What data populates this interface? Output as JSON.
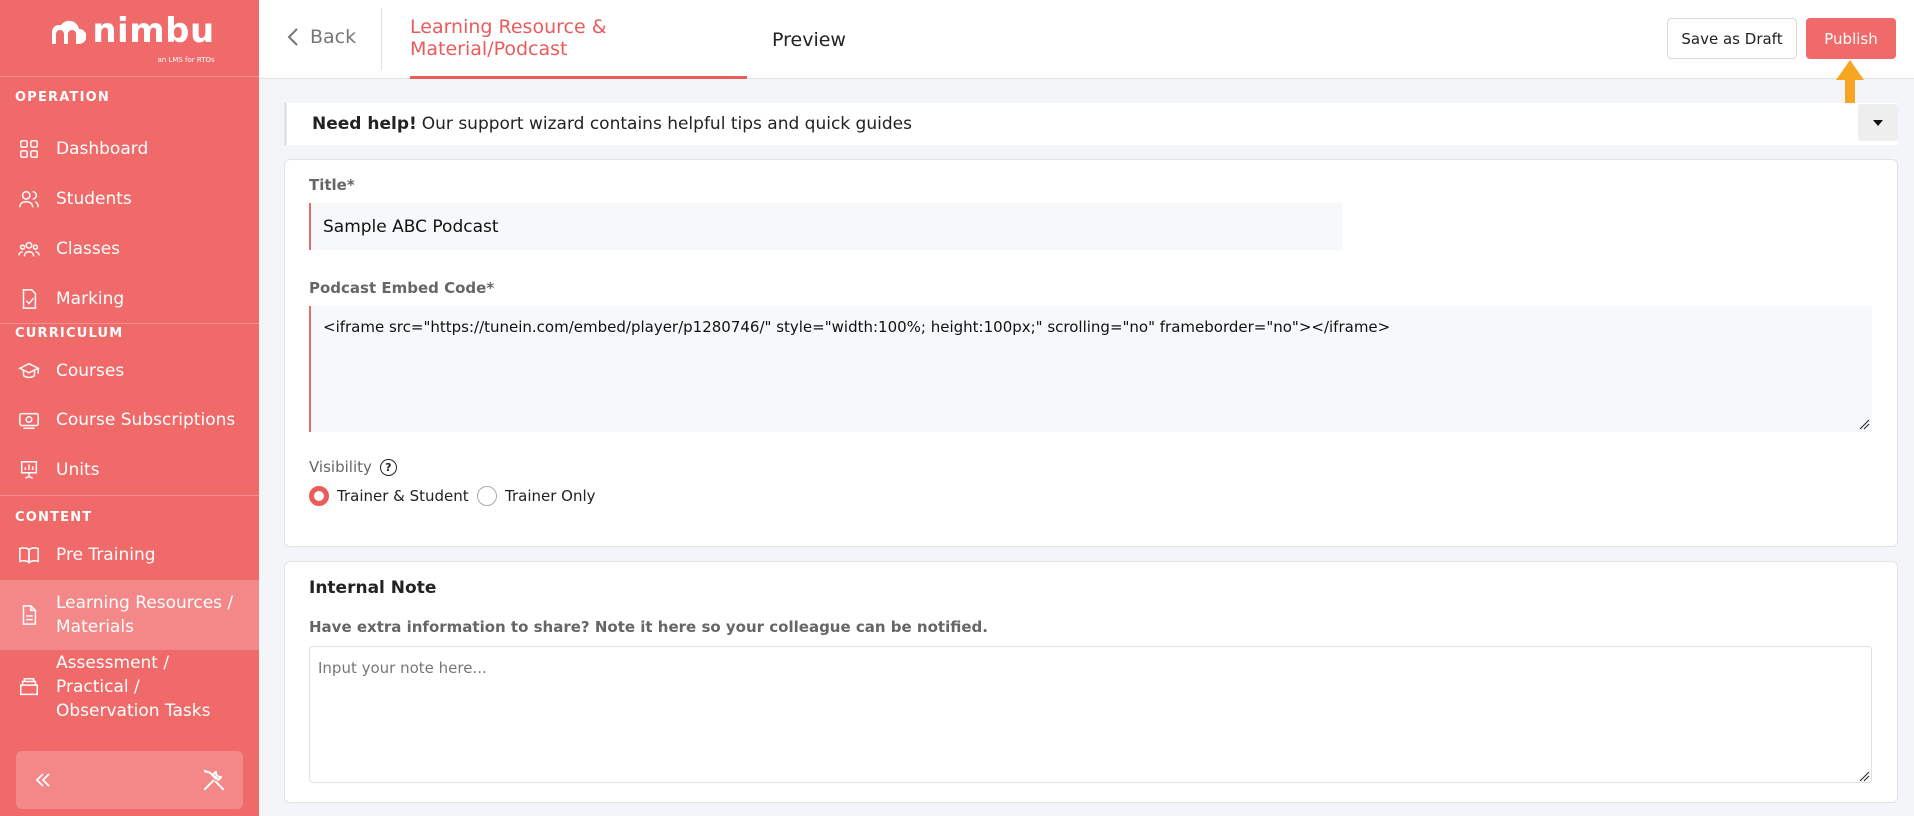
{
  "sidebar": {
    "logo": {
      "text": "nimbu",
      "tagline": "an LMS for RTOs"
    },
    "sections": [
      {
        "label": "OPERATION"
      },
      {
        "label": "CURRICULUM"
      },
      {
        "label": "CONTENT"
      }
    ],
    "items": [
      {
        "label": "Dashboard",
        "icon": "dashboard-icon"
      },
      {
        "label": "Students",
        "icon": "students-icon"
      },
      {
        "label": "Classes",
        "icon": "classes-icon"
      },
      {
        "label": "Marking",
        "icon": "marking-icon"
      },
      {
        "label": "Courses",
        "icon": "courses-icon"
      },
      {
        "label": "Course Subscriptions",
        "icon": "subscriptions-icon"
      },
      {
        "label": "Units",
        "icon": "units-icon"
      },
      {
        "label": "Pre Training",
        "icon": "book-icon"
      },
      {
        "label": "Learning Resources / Materials",
        "icon": "document-icon",
        "active": true
      },
      {
        "label": "Assessment / Practical / Observation Tasks",
        "icon": "tasks-icon"
      }
    ]
  },
  "topbar": {
    "back_label": "Back",
    "tabs": [
      {
        "label": "Learning Resource & Material/Podcast",
        "active": true
      },
      {
        "label": "Preview",
        "active": false
      }
    ],
    "save_draft_label": "Save as Draft",
    "publish_label": "Publish"
  },
  "help": {
    "bold": "Need help!",
    "text": "Our support wizard contains helpful tips and quick guides"
  },
  "form": {
    "title_label": "Title*",
    "title_value": "Sample ABC Podcast",
    "embed_label": "Podcast Embed Code*",
    "embed_value": "<iframe src=\"https://tunein.com/embed/player/p1280746/\" style=\"width:100%; height:100px;\" scrolling=\"no\" frameborder=\"no\"></iframe>",
    "visibility_label": "Visibility",
    "visibility_options": [
      {
        "label": "Trainer & Student",
        "selected": true
      },
      {
        "label": "Trainer Only",
        "selected": false
      }
    ]
  },
  "note": {
    "title": "Internal Note",
    "description": "Have extra information to share? Note it here so your colleague can be notified.",
    "placeholder": "Input your note here..."
  },
  "colors": {
    "brand": "#f06a6a",
    "accent": "#ea5b5b",
    "annotation_arrow": "#f5a623"
  }
}
